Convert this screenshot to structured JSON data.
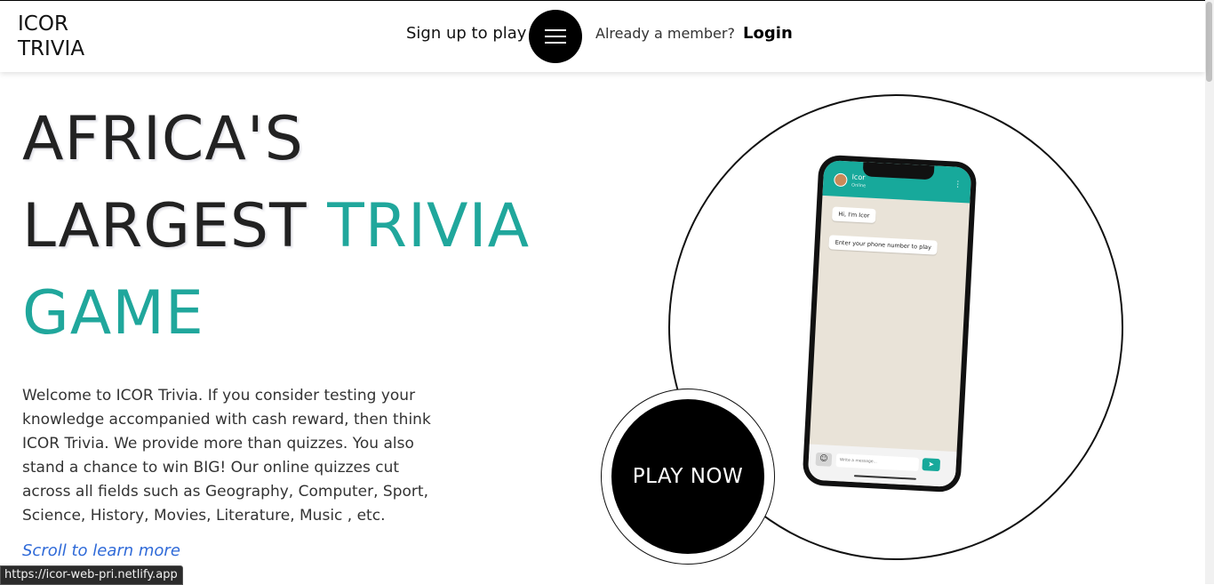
{
  "header": {
    "logo_line1": "ICOR",
    "logo_line2": "TRIVIA",
    "signup_label": "Sign up to play",
    "member_text": "Already a member?",
    "login_label": "Login"
  },
  "hero": {
    "headline_part1": "AFRICA'S",
    "headline_part2": "LARGEST",
    "headline_highlight1": "TRIVIA",
    "headline_highlight2": "GAME",
    "intro": "Welcome to ICOR Trivia. If you consider testing your knowledge accompanied with cash reward, then think ICOR Trivia. We provide more than quizzes. You also stand a chance to win BIG! Our online quizzes cut across all fields such as Geography, Computer, Sport, Science, History, Movies, Literature, Music , etc.",
    "scroll_label": "Scroll to learn more",
    "play_button": "PLAY NOW"
  },
  "phone": {
    "contact_name": "Icor",
    "contact_status": "Online",
    "messages": [
      "Hi, I'm Icor",
      "Enter your phone number to play"
    ],
    "input_placeholder": "Write a message..."
  },
  "status_bar": {
    "url": "https://icor-web-pri.netlify.app"
  },
  "colors": {
    "accent_teal": "#20a79c",
    "text_dark": "#222222",
    "button_black": "#000000",
    "link_blue": "#2f6ad8"
  },
  "icons": [
    "hamburger-menu-icon",
    "kebab-menu-icon",
    "emoji-icon",
    "send-icon"
  ]
}
